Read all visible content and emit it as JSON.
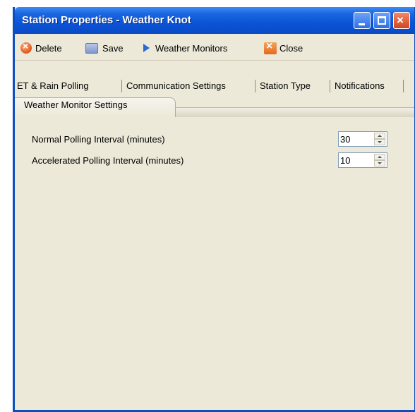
{
  "window": {
    "title": "Station Properties - Weather Knot",
    "controls": {
      "minimize_icon": "minimize-icon",
      "maximize_icon": "maximize-icon",
      "close_icon": "close-icon"
    },
    "close_glyph": "×",
    "accent": "#0a4ec0"
  },
  "toolbar": {
    "delete_label": "Delete",
    "save_label": "Save",
    "weather_monitors_label": "Weather Monitors",
    "close_label": "Close"
  },
  "tabs": {
    "items": [
      {
        "label": "ET & Rain Polling"
      },
      {
        "label": "Communication Settings"
      },
      {
        "label": "Station Type"
      },
      {
        "label": "Notifications"
      }
    ],
    "active": {
      "label": "Weather Monitor Settings"
    }
  },
  "settings": {
    "normal": {
      "label": "Normal Polling Interval (minutes)",
      "value": "30"
    },
    "accelerated": {
      "label": "Accelerated Polling Interval (minutes)",
      "value": "10"
    }
  }
}
